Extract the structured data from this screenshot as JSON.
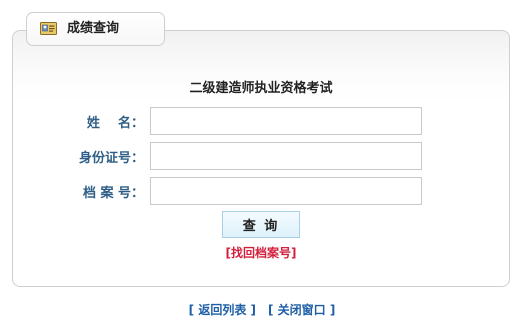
{
  "tab": {
    "label": "成绩查询",
    "icon": "id-card-icon"
  },
  "form": {
    "title": "二级建造师执业资格考试",
    "fields": [
      {
        "label": "姓    名：",
        "value": "",
        "placeholder": ""
      },
      {
        "label": "身份证号：",
        "value": "",
        "placeholder": ""
      },
      {
        "label": "档 案 号：",
        "value": "",
        "placeholder": ""
      }
    ],
    "submit_label": "查 询",
    "find_link": "[找回档案号]"
  },
  "footer": {
    "back_link": "[ 返回列表 ]",
    "close_link": "[ 关闭窗口 ]"
  },
  "colors": {
    "label": "#2f5f86",
    "find_link": "#d21f3c",
    "footer_link": "#1f5fa8",
    "button_bg": "#dff1fb"
  }
}
